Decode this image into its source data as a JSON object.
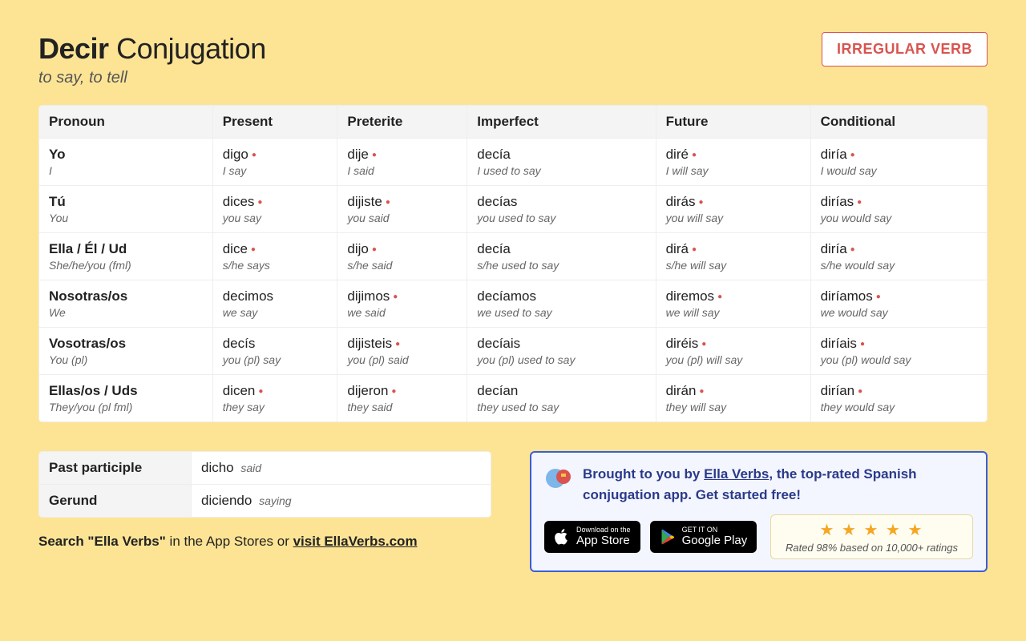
{
  "header": {
    "verb": "Decir",
    "title_suffix": "Conjugation",
    "subtitle": "to say, to tell",
    "badge": "IRREGULAR VERB"
  },
  "columns": [
    "Pronoun",
    "Present",
    "Preterite",
    "Imperfect",
    "Future",
    "Conditional"
  ],
  "rows": [
    {
      "pronoun": "Yo",
      "pronoun_trans": "I",
      "cells": [
        {
          "verb": "digo",
          "trans": "I say",
          "irr": true
        },
        {
          "verb": "dije",
          "trans": "I said",
          "irr": true
        },
        {
          "verb": "decía",
          "trans": "I used to say",
          "irr": false
        },
        {
          "verb": "diré",
          "trans": "I will say",
          "irr": true
        },
        {
          "verb": "diría",
          "trans": "I would say",
          "irr": true
        }
      ]
    },
    {
      "pronoun": "Tú",
      "pronoun_trans": "You",
      "cells": [
        {
          "verb": "dices",
          "trans": "you say",
          "irr": true
        },
        {
          "verb": "dijiste",
          "trans": "you said",
          "irr": true
        },
        {
          "verb": "decías",
          "trans": "you used to say",
          "irr": false
        },
        {
          "verb": "dirás",
          "trans": "you will say",
          "irr": true
        },
        {
          "verb": "dirías",
          "trans": "you would say",
          "irr": true
        }
      ]
    },
    {
      "pronoun": "Ella / Él / Ud",
      "pronoun_trans": "She/he/you (fml)",
      "cells": [
        {
          "verb": "dice",
          "trans": "s/he says",
          "irr": true
        },
        {
          "verb": "dijo",
          "trans": "s/he said",
          "irr": true
        },
        {
          "verb": "decía",
          "trans": "s/he used to say",
          "irr": false
        },
        {
          "verb": "dirá",
          "trans": "s/he will say",
          "irr": true
        },
        {
          "verb": "diría",
          "trans": "s/he would say",
          "irr": true
        }
      ]
    },
    {
      "pronoun": "Nosotras/os",
      "pronoun_trans": "We",
      "cells": [
        {
          "verb": "decimos",
          "trans": "we say",
          "irr": false
        },
        {
          "verb": "dijimos",
          "trans": "we said",
          "irr": true
        },
        {
          "verb": "decíamos",
          "trans": "we used to say",
          "irr": false
        },
        {
          "verb": "diremos",
          "trans": "we will say",
          "irr": true
        },
        {
          "verb": "diríamos",
          "trans": "we would say",
          "irr": true
        }
      ]
    },
    {
      "pronoun": "Vosotras/os",
      "pronoun_trans": "You (pl)",
      "cells": [
        {
          "verb": "decís",
          "trans": "you (pl) say",
          "irr": false
        },
        {
          "verb": "dijisteis",
          "trans": "you (pl) said",
          "irr": true
        },
        {
          "verb": "decíais",
          "trans": "you (pl) used to say",
          "irr": false
        },
        {
          "verb": "diréis",
          "trans": "you (pl) will say",
          "irr": true
        },
        {
          "verb": "diríais",
          "trans": "you (pl) would say",
          "irr": true
        }
      ]
    },
    {
      "pronoun": "Ellas/os / Uds",
      "pronoun_trans": "They/you (pl fml)",
      "cells": [
        {
          "verb": "dicen",
          "trans": "they say",
          "irr": true
        },
        {
          "verb": "dijeron",
          "trans": "they said",
          "irr": true
        },
        {
          "verb": "decían",
          "trans": "they used to say",
          "irr": false
        },
        {
          "verb": "dirán",
          "trans": "they will say",
          "irr": true
        },
        {
          "verb": "dirían",
          "trans": "they would say",
          "irr": true
        }
      ]
    }
  ],
  "participles": [
    {
      "label": "Past participle",
      "verb": "dicho",
      "trans": "said"
    },
    {
      "label": "Gerund",
      "verb": "diciendo",
      "trans": "saying"
    }
  ],
  "search_note": {
    "prefix": "Search \"Ella Verbs\"",
    "middle": " in the App Stores or ",
    "link": "visit EllaVerbs.com"
  },
  "promo": {
    "text_prefix": "Brought to you by ",
    "link": "Ella Verbs",
    "text_suffix": ", the top-rated Spanish conjugation app. Get started free!",
    "appstore_small": "Download on the",
    "appstore_big": "App Store",
    "play_small": "GET IT ON",
    "play_big": "Google Play",
    "rating_text": "Rated 98% based on 10,000+ ratings"
  }
}
